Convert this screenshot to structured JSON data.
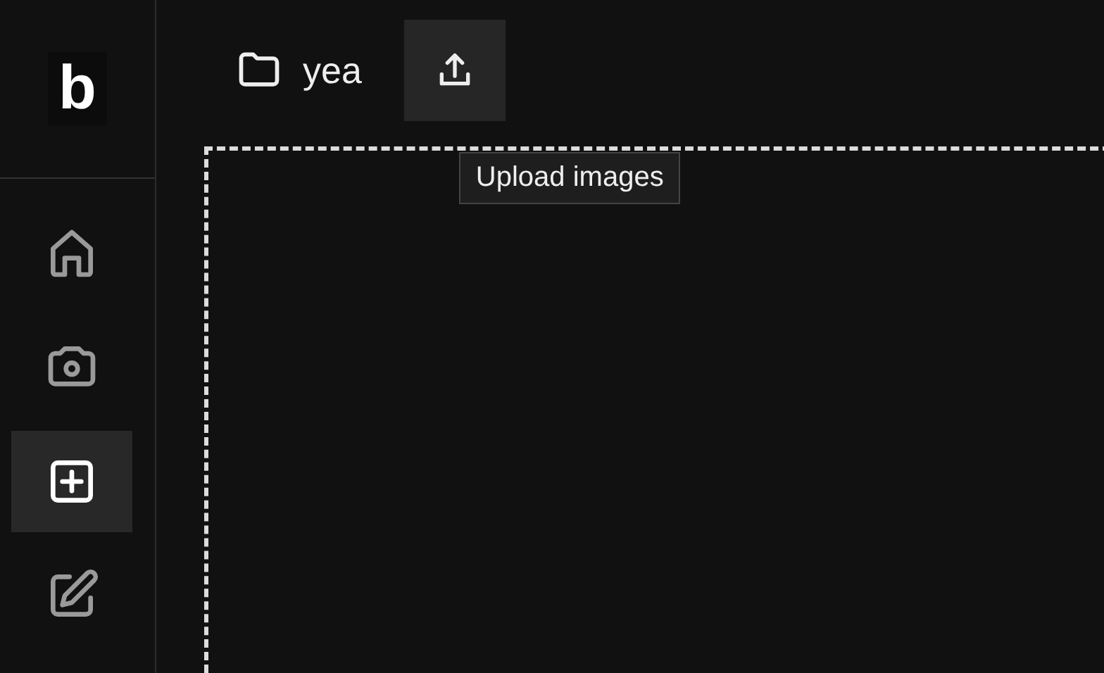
{
  "logo": "b",
  "nav": [
    {
      "kind": "home",
      "selected": false
    },
    {
      "kind": "camera",
      "selected": false
    },
    {
      "kind": "add",
      "selected": true
    },
    {
      "kind": "edit",
      "selected": false
    }
  ],
  "folder": {
    "name": "yea"
  },
  "upload": {
    "tooltip": "Upload images"
  }
}
